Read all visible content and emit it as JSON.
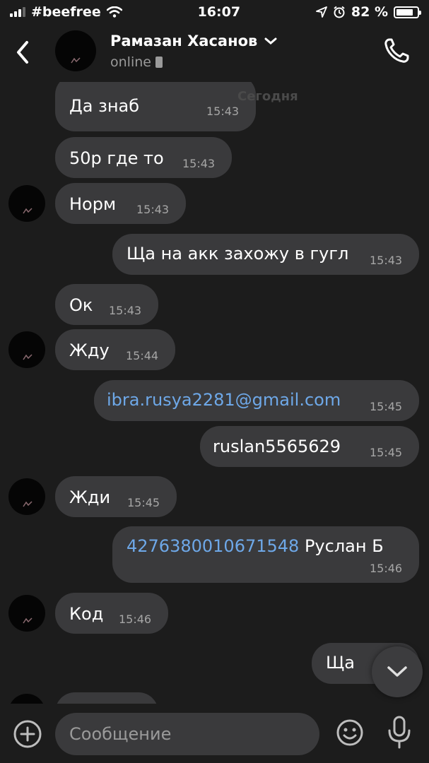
{
  "status_bar": {
    "carrier": "#beefree",
    "time": "16:07",
    "battery": "82 %",
    "battery_level": 0.82
  },
  "header": {
    "contact_name": "Рамазан Хасанов",
    "status": "online"
  },
  "messages": [
    {
      "side": "in",
      "text": "Да знаб",
      "time": "15:43"
    },
    {
      "side": "in",
      "text": "50р где то",
      "time": "15:43"
    },
    {
      "side": "in",
      "text": "Норм",
      "time": "15:43"
    },
    {
      "side": "out",
      "text": "Ща на акк захожу в гугл",
      "time": "15:43"
    },
    {
      "side": "in",
      "text": "Ок",
      "time": "15:43"
    },
    {
      "side": "in",
      "text": "Жду",
      "time": "15:44"
    },
    {
      "side": "out",
      "text": "ibra.rusya2281@gmail.com",
      "time": "15:45"
    },
    {
      "side": "out",
      "text": "ruslan5565629",
      "time": "15:45"
    },
    {
      "side": "in",
      "text": "Жди",
      "time": "15:45"
    },
    {
      "side": "out",
      "link": "4276380010671548",
      "text": "Руслан Б",
      "time": "15:46"
    },
    {
      "side": "in",
      "text": "Код",
      "time": "15:46"
    },
    {
      "side": "out",
      "text": "Ща",
      "time": ""
    }
  ],
  "overlay_text": "Сегодня",
  "input": {
    "placeholder": "Сообщение"
  },
  "colors": {
    "background": "#1c1c1c",
    "bubble": "#3a3a3c",
    "link": "#6ea8e8",
    "time": "#a6a6a6"
  },
  "icons": [
    "back-arrow-icon",
    "chevron-down-icon",
    "phone-icon",
    "add-icon",
    "emoji-icon",
    "microphone-icon",
    "scroll-down-icon",
    "wifi-icon",
    "location-icon",
    "alarm-icon"
  ]
}
